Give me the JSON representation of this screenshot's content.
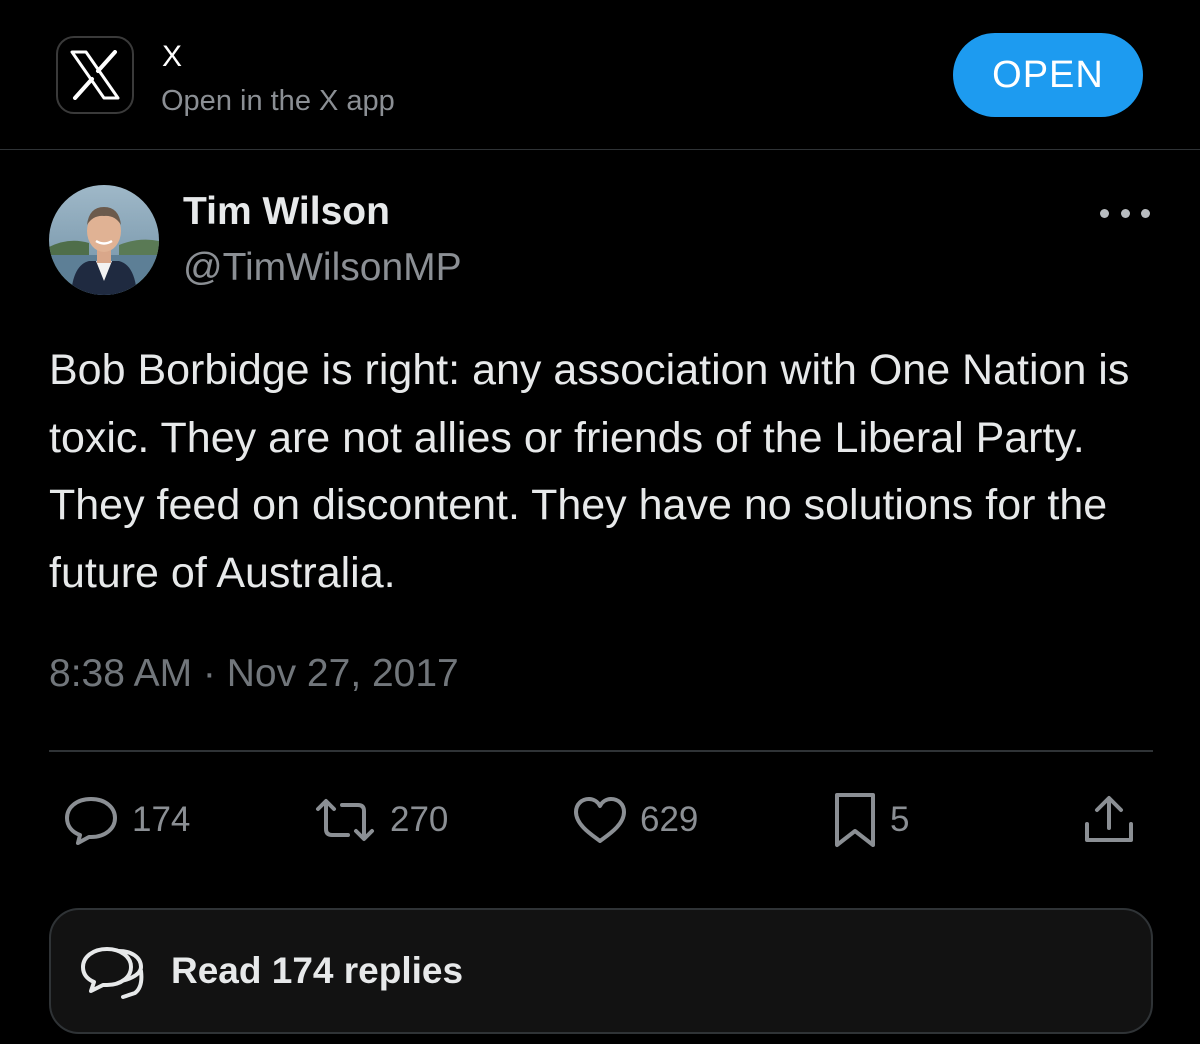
{
  "banner": {
    "app_name": "X",
    "subtitle": "Open in the X app",
    "open_label": "OPEN",
    "icon": "x-logo-icon"
  },
  "tweet": {
    "author_name": "Tim Wilson",
    "author_handle": "@TimWilsonMP",
    "text": "Bob Borbidge is right: any association with One Nation is toxic. They are not allies or friends of the Liberal Party. They feed on discontent. They have no solutions for the future of Australia.",
    "timestamp": "8:38 AM · Nov 27, 2017"
  },
  "actions": {
    "replies": "174",
    "reposts": "270",
    "likes": "629",
    "bookmarks": "5"
  },
  "read_replies_label": "Read 174 replies",
  "colors": {
    "background": "#000000",
    "accent": "#1d9bf0",
    "text": "#e7e9ea",
    "muted": "#71767b",
    "border": "#2f3336"
  }
}
